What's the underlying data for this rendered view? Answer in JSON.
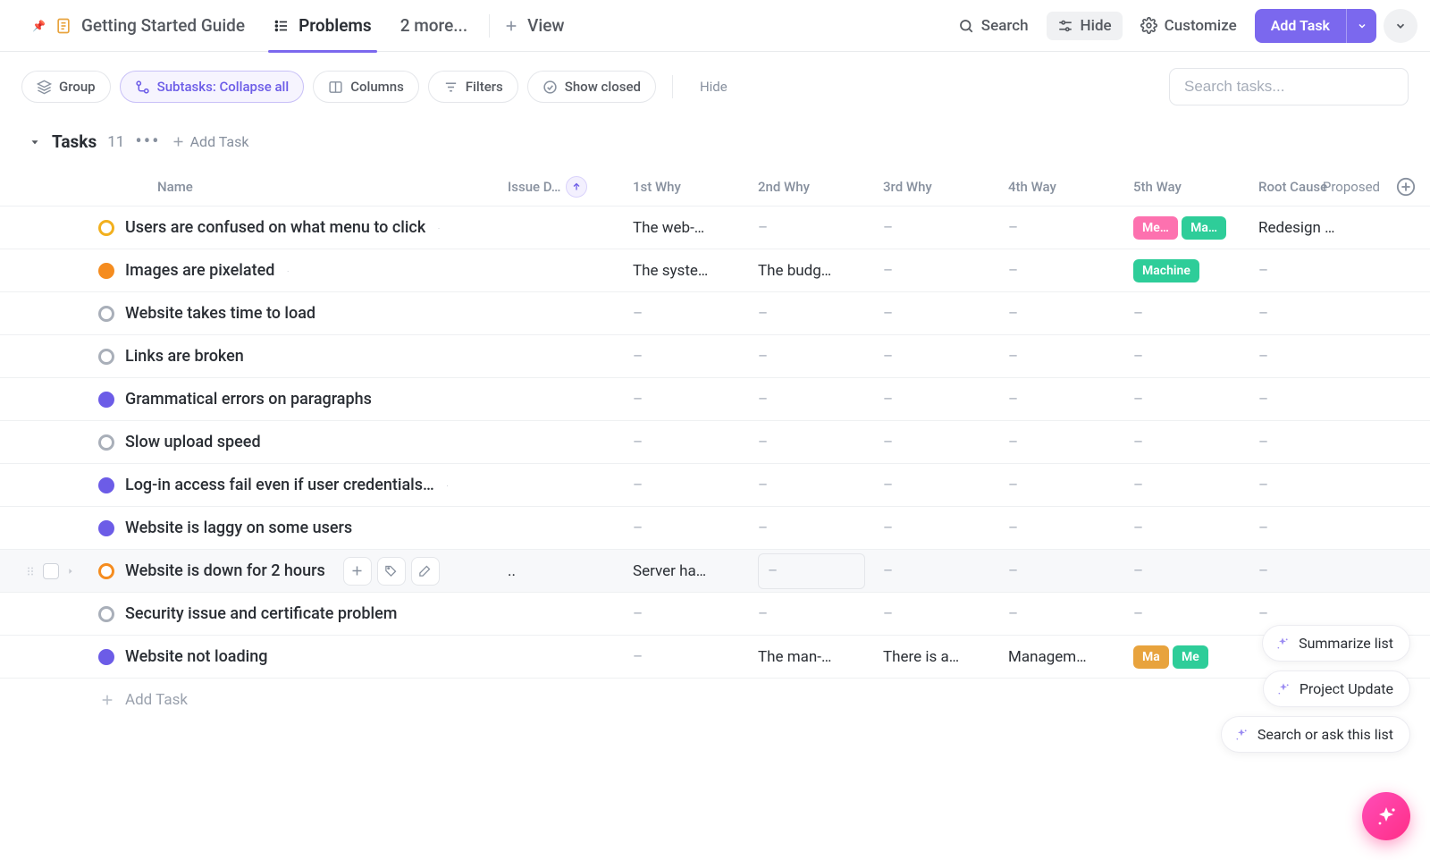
{
  "colors": {
    "violet": "#7b68ee",
    "pink_tag": "#fd71af",
    "teal_tag": "#2ecd99",
    "orange_tag": "#e8a33d"
  },
  "topnav": {
    "tabs": [
      {
        "label": "Getting Started Guide",
        "icon": "doc-icon"
      },
      {
        "label": "Problems",
        "icon": "list-icon",
        "active": true
      },
      {
        "label": "2 more...",
        "icon": null
      }
    ],
    "add_view": "View",
    "search": "Search",
    "hide": "Hide",
    "customize": "Customize",
    "add_task": "Add Task"
  },
  "toolbar": {
    "group": "Group",
    "subtasks": "Subtasks: Collapse all",
    "columns": "Columns",
    "filters": "Filters",
    "show_closed": "Show closed",
    "hide": "Hide",
    "search_placeholder": "Search tasks..."
  },
  "section": {
    "title": "Tasks",
    "count": "11",
    "add_task": "Add Task"
  },
  "columns": [
    "Name",
    "Issue D…",
    "1st Why",
    "2nd Why",
    "3rd Why",
    "4th Way",
    "5th Way",
    "Root Cause",
    "Proposed"
  ],
  "status_styles": {
    "yellow": {
      "fill": "#ffffff",
      "stroke": "#f2b01e"
    },
    "orange": {
      "fill": "#f58c1f",
      "stroke": "#f58c1f"
    },
    "grey": {
      "fill": "#ffffff",
      "stroke": "#a9afb9"
    },
    "violet": {
      "fill": "#6c5ce7",
      "stroke": "#6c5ce7"
    },
    "orange_ring": {
      "fill": "#ffffff",
      "stroke": "#f58c1f"
    }
  },
  "tasks": [
    {
      "status": "yellow",
      "name": "Users are confused on what menu to click",
      "c1": ".",
      "c2": "The web-…",
      "c3": "–",
      "c4": "–",
      "c5": "–",
      "root": [
        {
          "text": "Me…",
          "color": "#fd71af"
        },
        {
          "text": "Ma…",
          "color": "#2ecd99"
        }
      ],
      "proposed": "Redesign …"
    },
    {
      "status": "orange",
      "name": "Images are pixelated",
      "c1": ".",
      "c2": "The syste…",
      "c3": "The budg…",
      "c4": "–",
      "c5": "–",
      "root": [
        {
          "text": "Machine",
          "color": "#2ecd99",
          "wide": true
        }
      ],
      "proposed": "–"
    },
    {
      "status": "grey",
      "name": "Website takes time to load",
      "c1": "",
      "c2": "–",
      "c3": "–",
      "c4": "–",
      "c5": "–",
      "root": [],
      "proposed": "–"
    },
    {
      "status": "grey",
      "name": "Links are broken",
      "c1": "",
      "c2": "–",
      "c3": "–",
      "c4": "–",
      "c5": "–",
      "root": [],
      "proposed": "–"
    },
    {
      "status": "violet",
      "name": "Grammatical errors on paragraphs",
      "c1": "",
      "c2": "–",
      "c3": "–",
      "c4": "–",
      "c5": "–",
      "root": [],
      "proposed": "–"
    },
    {
      "status": "grey",
      "name": "Slow upload speed",
      "c1": "",
      "c2": "–",
      "c3": "–",
      "c4": "–",
      "c5": "–",
      "root": [],
      "proposed": "–"
    },
    {
      "status": "violet",
      "name": "Log-in access fail even if user credentials…",
      "c1": ".",
      "c2": "–",
      "c3": "–",
      "c4": "–",
      "c5": "–",
      "root": [],
      "proposed": "–"
    },
    {
      "status": "violet",
      "name": "Website is laggy on some users",
      "c1": "",
      "c2": "–",
      "c3": "–",
      "c4": "–",
      "c5": "–",
      "root": [],
      "proposed": "–"
    },
    {
      "status": "orange_ring",
      "name": "Website is down for 2 hours",
      "hovered": true,
      "c1": "..",
      "c2": "Server ha…",
      "c3_editable": true,
      "c3": "–",
      "c4": "–",
      "c5": "–",
      "root": [],
      "proposed": "–"
    },
    {
      "status": "grey",
      "name": "Security issue and certificate problem",
      "c1": "",
      "c2": "–",
      "c3": "–",
      "c4": "–",
      "c5": "–",
      "root": [],
      "proposed": "–"
    },
    {
      "status": "violet",
      "name": "Website not loading",
      "c1": "",
      "c2": "–",
      "c3": "The man-…",
      "c4": "There is a…",
      "c5": "Managem…",
      "root": [
        {
          "text": "Ma",
          "color": "#e8a33d"
        },
        {
          "text": "Me",
          "color": "#2ecd99"
        }
      ],
      "proposed": "",
      "truncated_root": true
    }
  ],
  "add_row": "Add Task",
  "ai": {
    "chips": [
      "Summarize list",
      "Project Update",
      "Search or ask this list"
    ]
  }
}
